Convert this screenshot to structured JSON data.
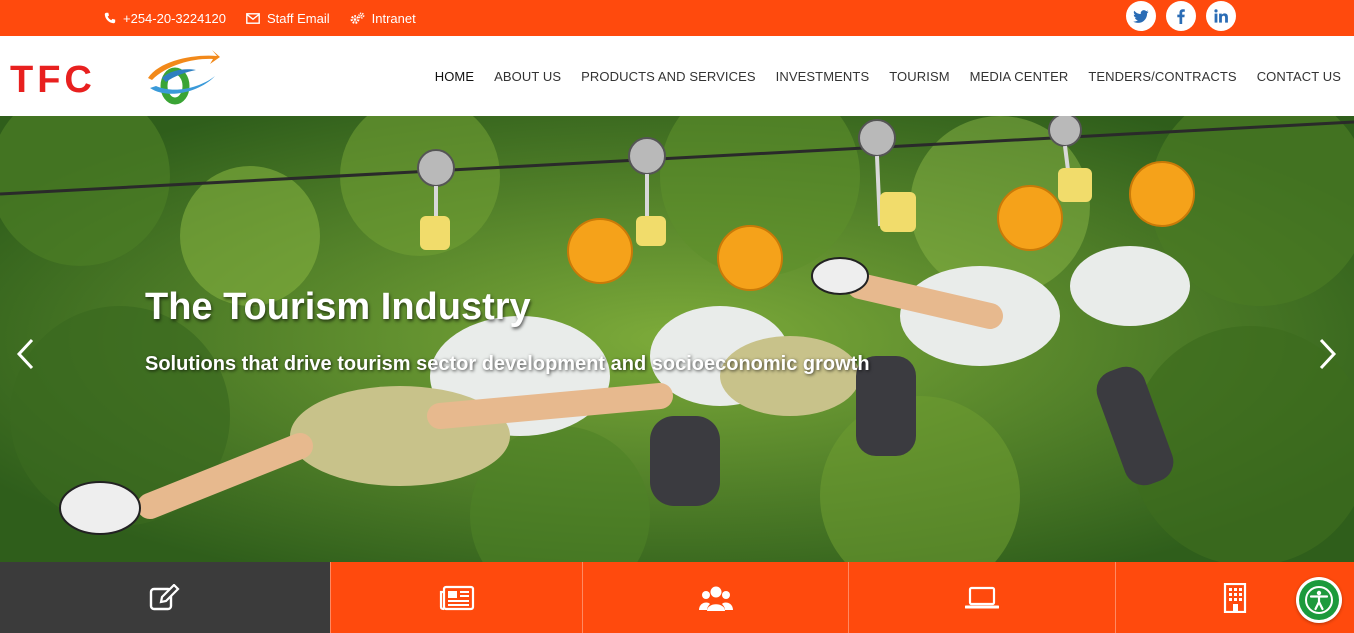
{
  "topbar": {
    "phone": "+254-20-3224120",
    "staff_email": "Staff Email",
    "intranet": "Intranet",
    "social_icons": [
      "twitter-icon",
      "facebook-icon",
      "linkedin-icon"
    ]
  },
  "header": {
    "logo_text": "TFC",
    "nav": [
      {
        "label": "HOME"
      },
      {
        "label": "ABOUT US"
      },
      {
        "label": "PRODUCTS AND SERVICES"
      },
      {
        "label": "INVESTMENTS"
      },
      {
        "label": "TOURISM"
      },
      {
        "label": "MEDIA CENTER"
      },
      {
        "label": "TENDERS/CONTRACTS"
      },
      {
        "label": "CONTACT US"
      }
    ]
  },
  "hero": {
    "title": "The Tourism Industry",
    "subtitle": "Solutions that drive tourism sector development and socioeconomic growth"
  },
  "tiles": [
    "edit-icon",
    "newspaper-icon",
    "users-icon",
    "laptop-icon",
    "building-icon"
  ],
  "colors": {
    "accent": "#ff4a0d",
    "dark_tile": "#3b3b3b",
    "accessibility": "#1c9a3c",
    "social": "#2a6cb5"
  }
}
